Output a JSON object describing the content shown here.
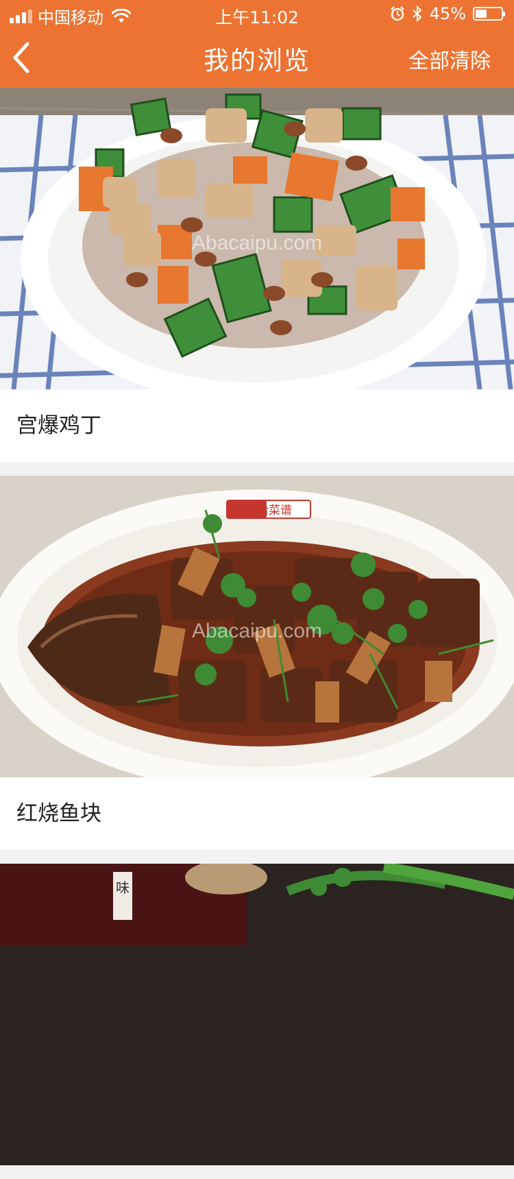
{
  "status_bar": {
    "carrier": "中国移动",
    "time": "上午11:02",
    "battery_percent": "45%",
    "battery_level": 0.45,
    "icons": [
      "signal-icon",
      "wifi-icon",
      "alarm-icon",
      "bluetooth-icon",
      "battery-icon"
    ]
  },
  "nav": {
    "back_icon": "chevron-left-icon",
    "title": "我的浏览",
    "clear_all": "全部清除"
  },
  "items": [
    {
      "title": "宫爆鸡丁",
      "watermark": "Abacaipu.com"
    },
    {
      "title": "红烧鱼块",
      "watermark": "Abacaipu.com",
      "plate_stamp": "香哈菜谱"
    },
    {
      "stamp": "味"
    }
  ],
  "colors": {
    "header": "#ec7332",
    "background": "#f2f2f2",
    "card": "#ffffff",
    "text": "#222222"
  }
}
